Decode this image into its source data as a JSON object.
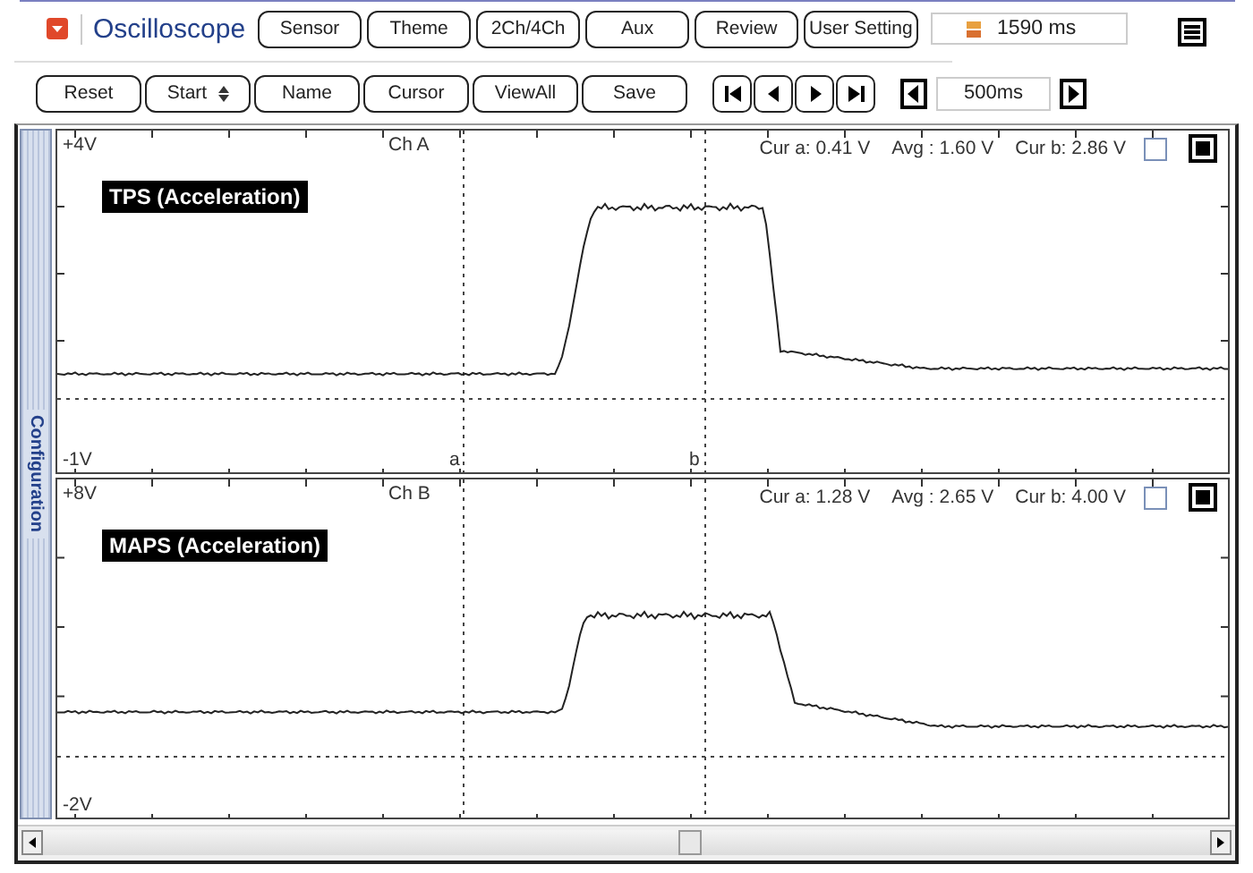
{
  "app": {
    "title": "Oscilloscope"
  },
  "top_buttons": [
    "Sensor",
    "Theme",
    "2Ch/4Ch",
    "Aux",
    "Review",
    "User Setting"
  ],
  "time_readout": "1590 ms",
  "bottom_buttons": [
    {
      "label": "Reset",
      "kind": "plain"
    },
    {
      "label": "Start",
      "kind": "spinner"
    },
    {
      "label": "Name",
      "kind": "plain"
    },
    {
      "label": "Cursor",
      "kind": "plain"
    },
    {
      "label": "ViewAll",
      "kind": "plain"
    },
    {
      "label": "Save",
      "kind": "plain"
    }
  ],
  "time_scale": "500ms",
  "sidebar": {
    "label": "Configuration"
  },
  "channels": [
    {
      "name": "Ch A",
      "top": "+4V",
      "bottom": "-1V",
      "title": "TPS (Acceleration)",
      "cur_a": "Cur a: 0.41 V",
      "avg": "Avg  : 1.60 V",
      "cur_b": "Cur b: 2.86 V",
      "cursor_labels": [
        "a",
        "b"
      ]
    },
    {
      "name": "Ch B",
      "top": "+8V",
      "bottom": "-2V",
      "title": "MAPS (Acceleration)",
      "cur_a": "Cur a: 1.28 V",
      "avg": "Avg  : 2.65 V",
      "cur_b": "Cur b: 4.00 V"
    }
  ]
}
